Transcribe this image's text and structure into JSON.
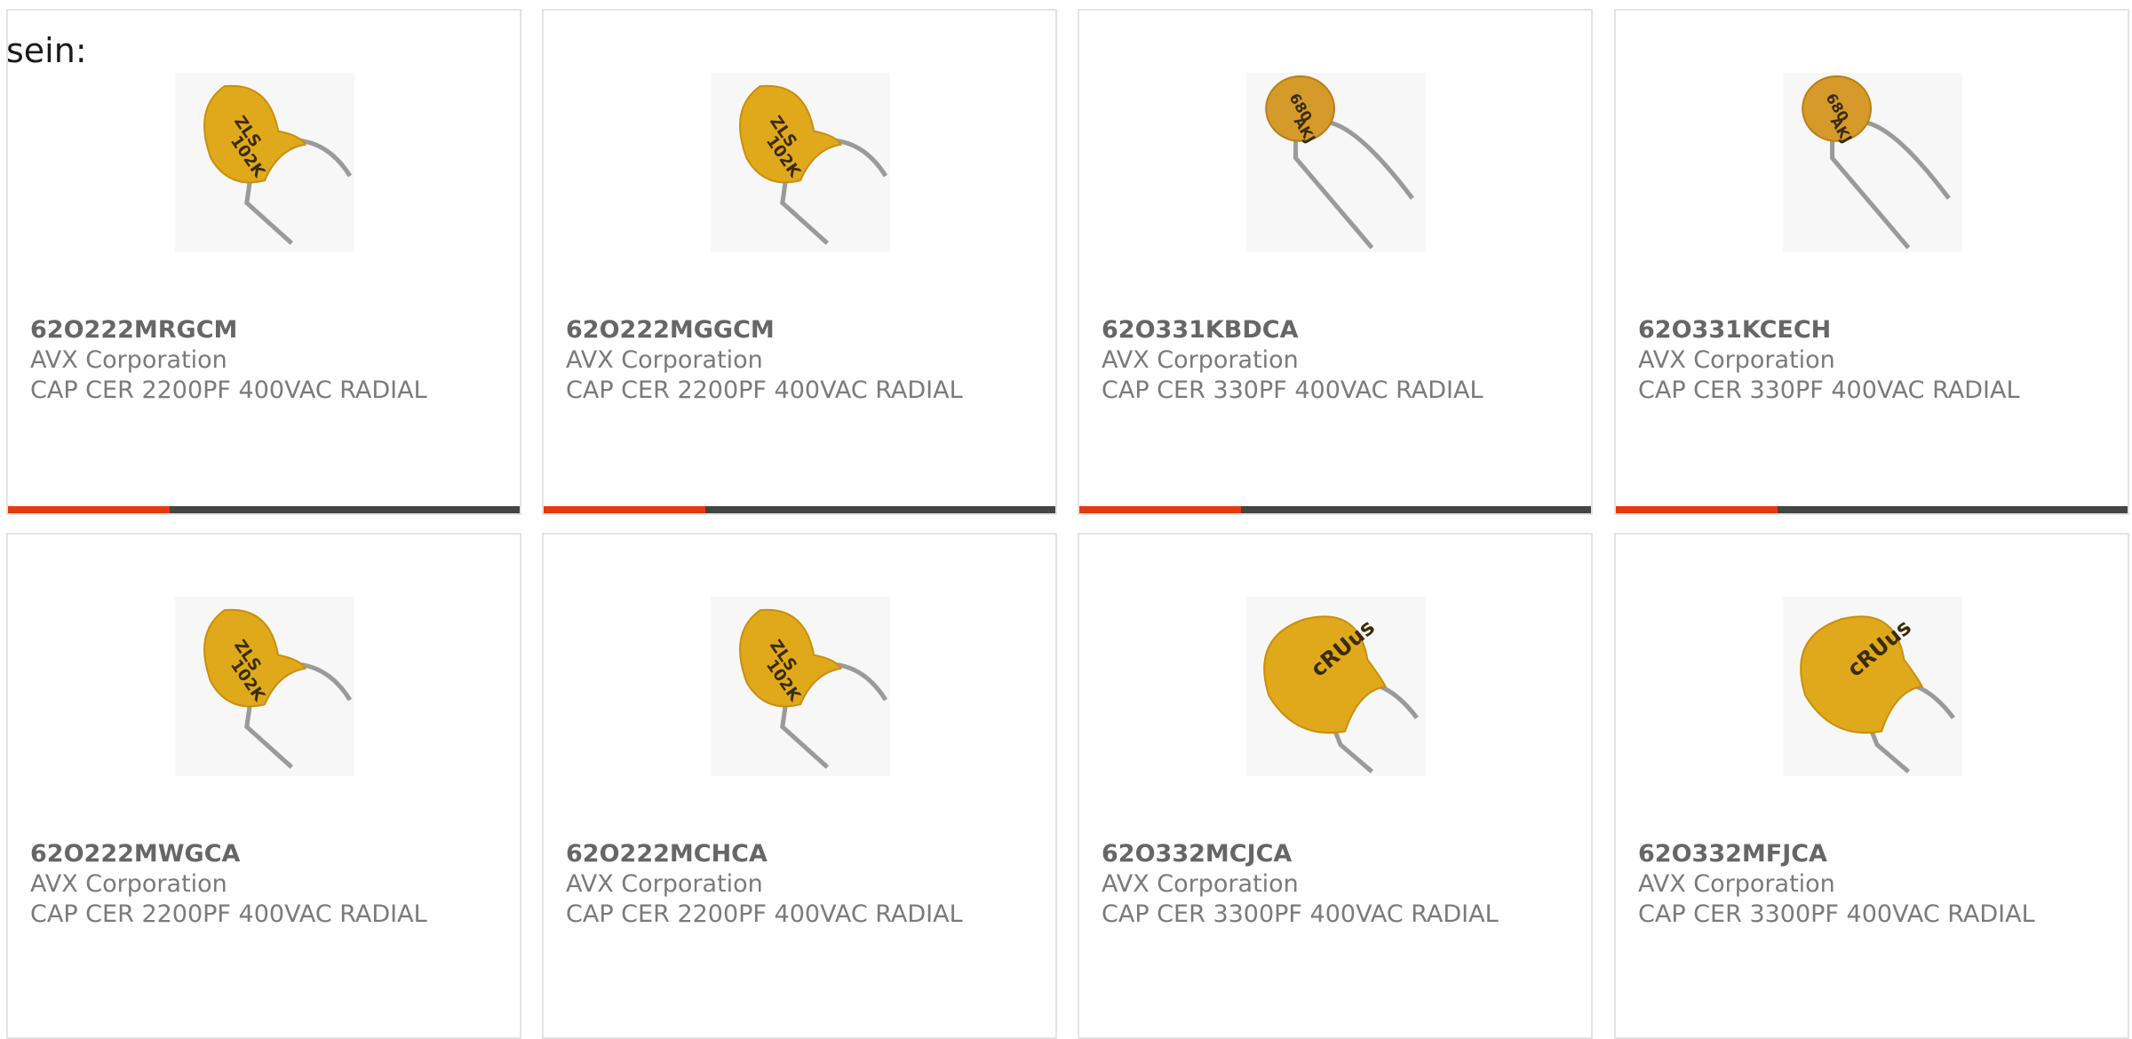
{
  "intro_text": "sein:",
  "colors": {
    "accent": "#e8390e",
    "bar": "#444444",
    "part_number": "#666666",
    "text": "#7a7a7a",
    "border": "#e3e3e3"
  },
  "products": [
    {
      "part_number": "62O222MRGCM",
      "manufacturer": "AVX Corporation",
      "description": "CAP CER 2200PF 400VAC RADIAL",
      "image_icon": "capacitor-teardrop-icon"
    },
    {
      "part_number": "62O222MGGCM",
      "manufacturer": "AVX Corporation",
      "description": "CAP CER 2200PF 400VAC RADIAL",
      "image_icon": "capacitor-teardrop-icon"
    },
    {
      "part_number": "62O331KBDCA",
      "manufacturer": "AVX Corporation",
      "description": "CAP CER 330PF 400VAC RADIAL",
      "image_icon": "capacitor-disc-icon"
    },
    {
      "part_number": "62O331KCECH",
      "manufacturer": "AVX Corporation",
      "description": "CAP CER 330PF 400VAC RADIAL",
      "image_icon": "capacitor-disc-icon"
    },
    {
      "part_number": "62O222MWGCA",
      "manufacturer": "AVX Corporation",
      "description": "CAP CER 2200PF 400VAC RADIAL",
      "image_icon": "capacitor-teardrop-icon"
    },
    {
      "part_number": "62O222MCHCA",
      "manufacturer": "AVX Corporation",
      "description": "CAP CER 2200PF 400VAC RADIAL",
      "image_icon": "capacitor-teardrop-icon"
    },
    {
      "part_number": "62O332MCJCA",
      "manufacturer": "AVX Corporation",
      "description": "CAP CER 3300PF 400VAC RADIAL",
      "image_icon": "capacitor-large-icon"
    },
    {
      "part_number": "62O332MFJCA",
      "manufacturer": "AVX Corporation",
      "description": "CAP CER 3300PF 400VAC RADIAL",
      "image_icon": "capacitor-large-icon"
    }
  ]
}
